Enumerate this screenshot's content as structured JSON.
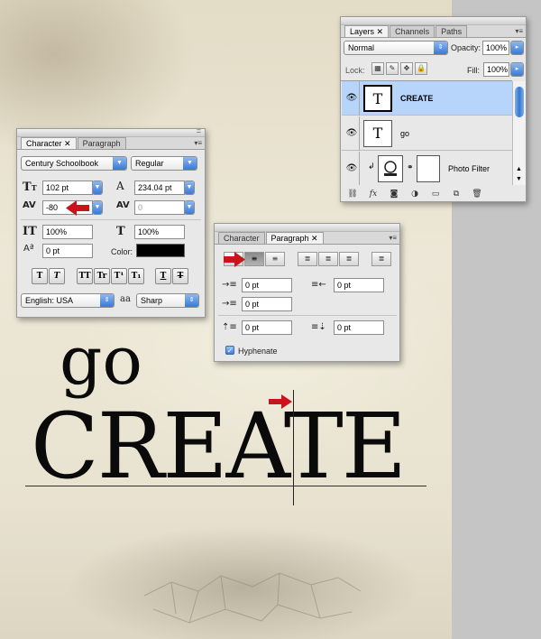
{
  "canvas": {
    "word_small": "go",
    "word_large": "CREATE"
  },
  "layers": {
    "tabs": [
      "Layers",
      "Channels",
      "Paths"
    ],
    "blend_mode": "Normal",
    "opacity_label": "Opacity:",
    "opacity_value": "100%",
    "lock_label": "Lock:",
    "fill_label": "Fill:",
    "fill_value": "100%",
    "rows": [
      {
        "name": "CREATE",
        "thumb": "T",
        "selected": true
      },
      {
        "name": "go",
        "thumb": "T",
        "selected": false
      },
      {
        "name": "Photo Filter",
        "thumb": "",
        "selected": false
      }
    ],
    "footer_icons": [
      "link-icon",
      "fx-icon",
      "mask-icon",
      "adjustment-icon",
      "group-folder-icon",
      "new-layer-icon",
      "trash-icon"
    ],
    "fx_text": "fx"
  },
  "character": {
    "tabs": [
      "Character",
      "Paragraph"
    ],
    "font_family": "Century Schoolbook",
    "font_style": "Regular",
    "font_size": "102 pt",
    "leading": "234.04 pt",
    "kerning": "-80",
    "tracking": "0",
    "vertical_scale": "100%",
    "horizontal_scale": "100%",
    "baseline_shift": "0 pt",
    "color_label": "Color:",
    "color_value": "#000000",
    "style_buttons": [
      "T",
      "T",
      "TT",
      "Tr",
      "T¹",
      "T₁",
      "T",
      "T"
    ],
    "language": "English: USA",
    "antialias_icon": "aa",
    "antialias": "Sharp"
  },
  "paragraph": {
    "tabs": [
      "Character",
      "Paragraph"
    ],
    "indent_left": "0 pt",
    "indent_right": "0 pt",
    "indent_first": "0 pt",
    "space_before": "0 pt",
    "space_after": "0 pt",
    "hyphenate_label": "Hyphenate",
    "hyphenate_checked": true
  },
  "colors": {
    "arrow_red": "#c8141a",
    "selection_blue": "#b7d4fb",
    "aqua_blue": "#3a7ad6"
  }
}
